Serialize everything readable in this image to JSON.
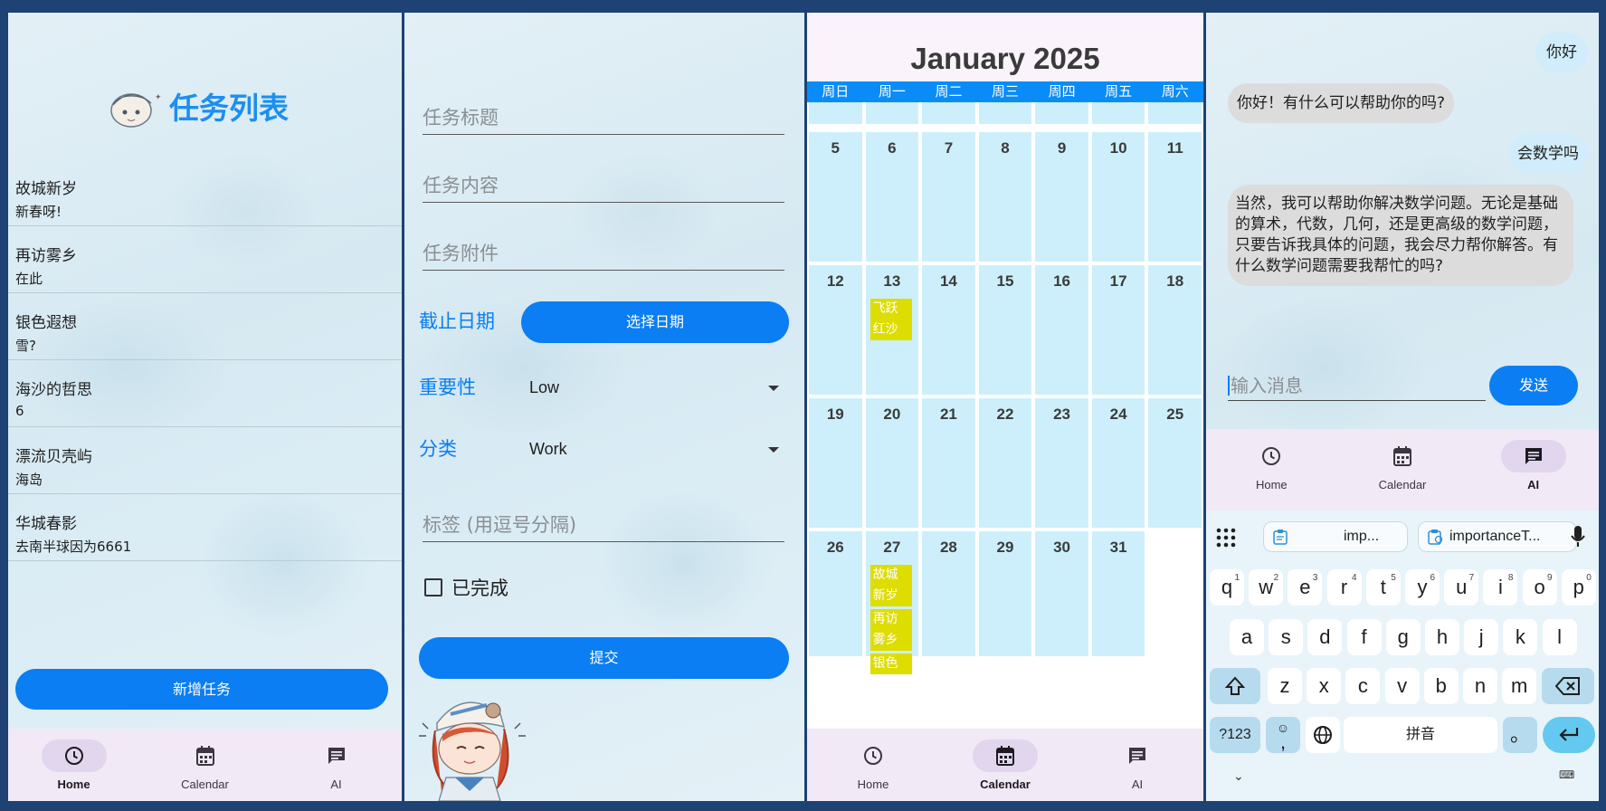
{
  "panel1": {
    "title": "任务列表",
    "tasks": [
      {
        "title": "故城新岁",
        "content": "新春呀!"
      },
      {
        "title": "再访雾乡",
        "content": "在此"
      },
      {
        "title": "银色遐想",
        "content": "雪?"
      },
      {
        "title": "海沙的哲思",
        "content": "6"
      },
      {
        "title": "漂流贝壳屿",
        "content": "海岛"
      },
      {
        "title": "华城春影",
        "content": "去南半球因为6661"
      }
    ],
    "add_button": "新增任务",
    "nav": [
      {
        "label": "Home",
        "icon": "clock-icon",
        "active": true
      },
      {
        "label": "Calendar",
        "icon": "calendar-icon",
        "active": false
      },
      {
        "label": "AI",
        "icon": "chat-icon",
        "active": false
      }
    ]
  },
  "panel2": {
    "title_placeholder": "任务标题",
    "content_placeholder": "任务内容",
    "attachment_placeholder": "任务附件",
    "deadline_label": "截止日期",
    "pick_date_button": "选择日期",
    "importance_label": "重要性",
    "importance_value": "Low",
    "category_label": "分类",
    "category_value": "Work",
    "tags_placeholder": "标签 (用逗号分隔)",
    "completed_label": "已完成",
    "submit_button": "提交"
  },
  "panel3": {
    "month_title": "January 2025",
    "weekdays": [
      "周日",
      "周一",
      "周二",
      "周三",
      "周四",
      "周五",
      "周六"
    ],
    "weeks": [
      [
        "",
        "",
        "",
        "",
        "",
        "",
        ""
      ],
      [
        "5",
        "6",
        "7",
        "8",
        "9",
        "10",
        "11"
      ],
      [
        "12",
        "13",
        "14",
        "15",
        "16",
        "17",
        "18"
      ],
      [
        "19",
        "20",
        "21",
        "22",
        "23",
        "24",
        "25"
      ],
      [
        "26",
        "27",
        "28",
        "29",
        "30",
        "31",
        ""
      ]
    ],
    "events": [
      {
        "week": 2,
        "day": 1,
        "slot": 0,
        "lines": [
          "飞跃",
          "红沙"
        ]
      },
      {
        "week": 4,
        "day": 1,
        "slot": 0,
        "lines": [
          "故城",
          "新岁"
        ]
      },
      {
        "week": 4,
        "day": 1,
        "slot": 1,
        "lines": [
          "再访",
          "雾乡"
        ]
      },
      {
        "week": 4,
        "day": 1,
        "slot": 2,
        "lines": [
          "银色"
        ]
      }
    ],
    "event_color": "#dedd00",
    "cell_color": "#cdeffc",
    "header_color": "#0a8cf8",
    "nav": [
      {
        "label": "Home",
        "icon": "clock-icon",
        "active": false
      },
      {
        "label": "Calendar",
        "icon": "calendar-icon",
        "active": true
      },
      {
        "label": "AI",
        "icon": "chat-icon",
        "active": false
      }
    ]
  },
  "panel4": {
    "messages": [
      {
        "from": "user",
        "text": "你好"
      },
      {
        "from": "bot",
        "text": "你好！有什么可以帮助你的吗?"
      },
      {
        "from": "user",
        "text": "会数学吗"
      },
      {
        "from": "bot",
        "text": "当然，我可以帮助你解决数学问题。无论是基础的算术，代数，几何，还是更高级的数学问题，只要告诉我具体的问题，我会尽力帮你解答。有什么数学问题需要我帮忙的吗?"
      }
    ],
    "input_placeholder": "输入消息",
    "send_button": "发送",
    "nav": [
      {
        "label": "Home",
        "icon": "clock-icon",
        "active": false
      },
      {
        "label": "Calendar",
        "icon": "calendar-icon",
        "active": false
      },
      {
        "label": "AI",
        "icon": "chat-icon",
        "active": true
      }
    ],
    "keyboard": {
      "suggestions": [
        "imp...",
        "importanceT..."
      ],
      "row1": [
        [
          "q",
          "1"
        ],
        [
          "w",
          "2"
        ],
        [
          "e",
          "3"
        ],
        [
          "r",
          "4"
        ],
        [
          "t",
          "5"
        ],
        [
          "y",
          "6"
        ],
        [
          "u",
          "7"
        ],
        [
          "i",
          "8"
        ],
        [
          "o",
          "9"
        ],
        [
          "p",
          "0"
        ]
      ],
      "row2": [
        "a",
        "s",
        "d",
        "f",
        "g",
        "h",
        "j",
        "k",
        "l"
      ],
      "row3": [
        "z",
        "x",
        "c",
        "v",
        "b",
        "n",
        "m"
      ],
      "symbols_key": "?123",
      "emoji_key_sub": ",",
      "space_label": "拼音",
      "period_key": "。"
    }
  }
}
